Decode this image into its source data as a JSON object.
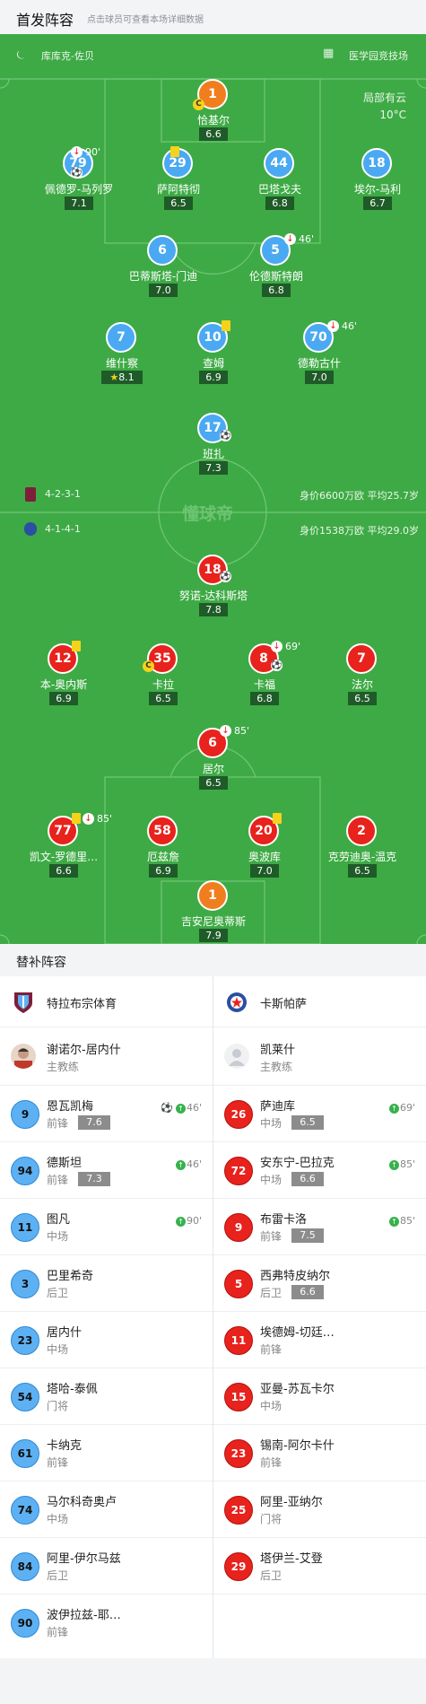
{
  "header": {
    "title": "首发阵容",
    "subtitle": "点击球员可查看本场详细数据"
  },
  "pitch": {
    "coach_label": "库库克-佐贝",
    "venue": "医学园竞技场",
    "weather": "局部有云",
    "temperature": "10°C",
    "watermark": "懂球帝",
    "home": {
      "formation": "4-2-3-1",
      "value": "身价6600万欧 平均25.7岁"
    },
    "away": {
      "formation": "4-1-4-1",
      "value": "身价1538万欧 平均29.0岁"
    }
  },
  "home_players": [
    {
      "num": "1",
      "name": "恰基尔",
      "rating": "6.6",
      "gk": true
    },
    {
      "num": "79",
      "name": "佩德罗-马列罗",
      "rating": "7.1",
      "event": "90'"
    },
    {
      "num": "29",
      "name": "萨阿特彻",
      "rating": "6.5"
    },
    {
      "num": "44",
      "name": "巴塔戈夫",
      "rating": "6.8"
    },
    {
      "num": "18",
      "name": "埃尔-马利",
      "rating": "6.7"
    },
    {
      "num": "6",
      "name": "巴蒂斯塔-门迪",
      "rating": "7.0"
    },
    {
      "num": "5",
      "name": "伦德斯特朗",
      "rating": "6.8",
      "event": "46'"
    },
    {
      "num": "7",
      "name": "维什察",
      "rating": "8.1"
    },
    {
      "num": "10",
      "name": "查姆",
      "rating": "6.9"
    },
    {
      "num": "70",
      "name": "德勒古什",
      "rating": "7.0",
      "event": "46'"
    },
    {
      "num": "17",
      "name": "班扎",
      "rating": "7.3"
    }
  ],
  "away_players": [
    {
      "num": "18",
      "name": "努诺-达科斯塔",
      "rating": "7.8"
    },
    {
      "num": "12",
      "name": "本-奥内斯",
      "rating": "6.9"
    },
    {
      "num": "35",
      "name": "卡拉",
      "rating": "6.5"
    },
    {
      "num": "8",
      "name": "卡福",
      "rating": "6.8",
      "event": "69'"
    },
    {
      "num": "7",
      "name": "法尔",
      "rating": "6.5"
    },
    {
      "num": "6",
      "name": "居尔",
      "rating": "6.5",
      "event": "85'"
    },
    {
      "num": "77",
      "name": "凯文-罗德里…",
      "rating": "6.6",
      "event": "85'"
    },
    {
      "num": "58",
      "name": "厄兹詹",
      "rating": "6.9"
    },
    {
      "num": "20",
      "name": "奥波库",
      "rating": "7.0"
    },
    {
      "num": "2",
      "name": "克劳迪奥-温克",
      "rating": "6.5"
    },
    {
      "num": "1",
      "name": "吉安尼奥蒂斯",
      "rating": "7.9",
      "gk": true
    }
  ],
  "subs": {
    "title": "替补阵容",
    "home": {
      "team": "特拉布宗体育",
      "coach": {
        "name": "谢诺尔-居内什",
        "role": "主教练"
      },
      "players": [
        {
          "num": "9",
          "name": "恩瓦凯梅",
          "pos": "前锋",
          "rating": "7.6",
          "status": "46'",
          "goal": true
        },
        {
          "num": "94",
          "name": "德斯坦",
          "pos": "前锋",
          "rating": "7.3",
          "status": "46'"
        },
        {
          "num": "11",
          "name": "图凡",
          "pos": "中场",
          "status": "90'"
        },
        {
          "num": "3",
          "name": "巴里希奇",
          "pos": "后卫"
        },
        {
          "num": "23",
          "name": "居内什",
          "pos": "中场"
        },
        {
          "num": "54",
          "name": "塔哈-泰佩",
          "pos": "门将"
        },
        {
          "num": "61",
          "name": "卡纳克",
          "pos": "前锋"
        },
        {
          "num": "74",
          "name": "马尔科奇奥卢",
          "pos": "中场"
        },
        {
          "num": "84",
          "name": "阿里-伊尔马兹",
          "pos": "后卫"
        },
        {
          "num": "90",
          "name": "波伊拉兹-耶…",
          "pos": "前锋"
        }
      ]
    },
    "away": {
      "team": "卡斯帕萨",
      "coach": {
        "name": "凯莱什",
        "role": "主教练"
      },
      "players": [
        {
          "num": "26",
          "name": "萨迪库",
          "pos": "中场",
          "rating": "6.5",
          "status": "69'"
        },
        {
          "num": "72",
          "name": "安东宁-巴拉克",
          "pos": "中场",
          "rating": "6.6",
          "status": "85'"
        },
        {
          "num": "9",
          "name": "布雷卡洛",
          "pos": "前锋",
          "rating": "7.5",
          "status": "85'"
        },
        {
          "num": "5",
          "name": "西弗特皮纳尔",
          "pos": "后卫",
          "rating": "6.6"
        },
        {
          "num": "11",
          "name": "埃德姆-切廷…",
          "pos": "前锋"
        },
        {
          "num": "15",
          "name": "亚曼-苏瓦卡尔",
          "pos": "中场"
        },
        {
          "num": "23",
          "name": "锡南-阿尔卡什",
          "pos": "前锋"
        },
        {
          "num": "25",
          "name": "阿里-亚纳尔",
          "pos": "门将"
        },
        {
          "num": "29",
          "name": "塔伊兰-艾登",
          "pos": "后卫"
        }
      ]
    }
  },
  "colors": {
    "pitch": "#3eaa45",
    "home": "#4aa9f2",
    "away": "#e8221c",
    "gk": "#f07e1f",
    "rating_bg": "#1f5b28"
  }
}
